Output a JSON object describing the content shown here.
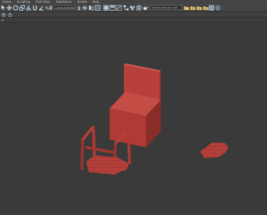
{
  "menubar": {
    "items": [
      "ientos",
      "Scripting",
      "Civil View",
      "Substance",
      "Arnold",
      "Help"
    ]
  },
  "toolbar": {
    "selection_set": "Create Selection Set",
    "named_selection": "Create Selection Set"
  },
  "colors": {
    "model_red": "#b8403a",
    "model_red_dark": "#8e2f2b",
    "viewport_bg": "#3a3a3a",
    "ui_bg": "#444444"
  },
  "viewport": {
    "objects": [
      "chair-back",
      "chair-seat-box",
      "chair-legs",
      "seat-grid",
      "loose-grid-piece"
    ]
  }
}
